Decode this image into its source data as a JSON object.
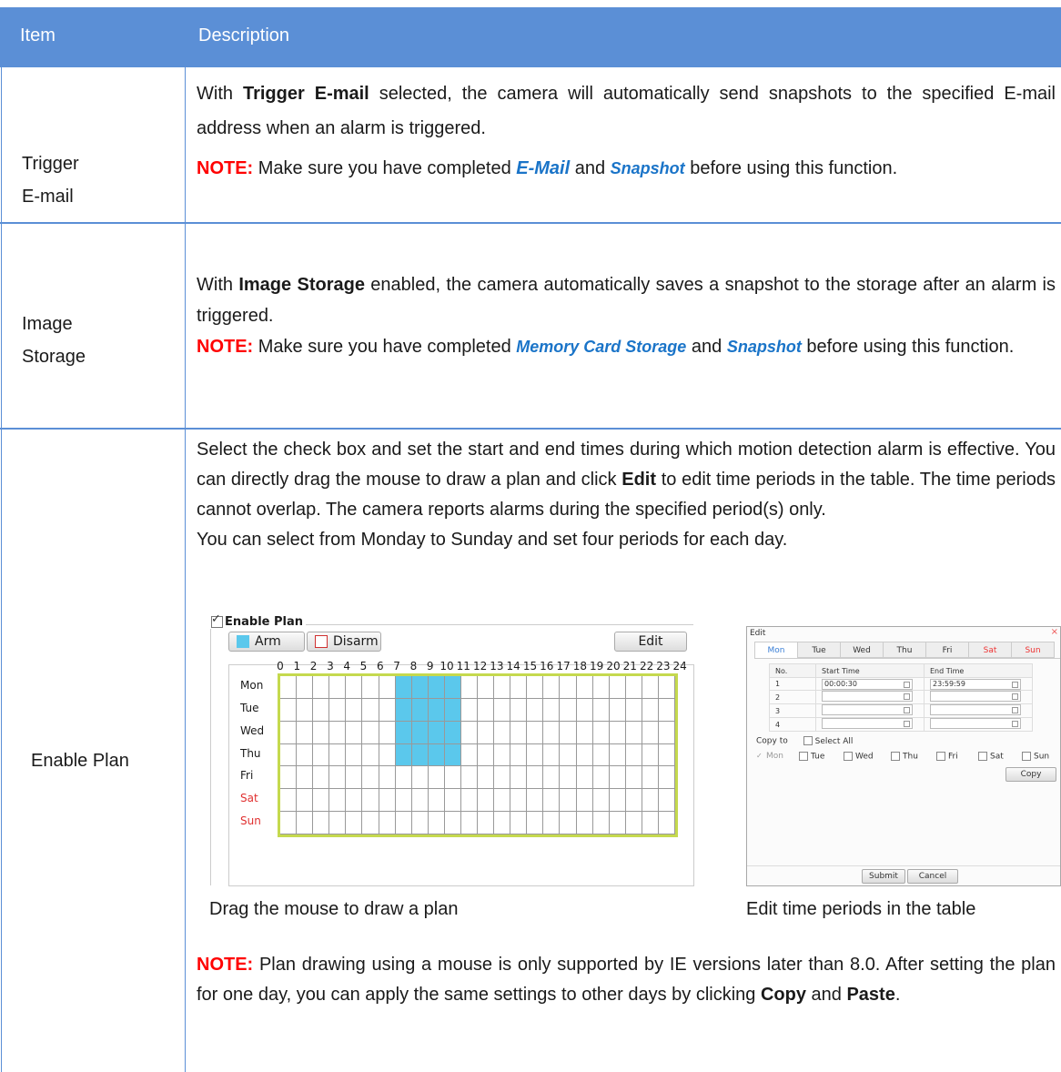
{
  "header": {
    "item": "Item",
    "description": "Description"
  },
  "rows": [
    {
      "item_line1": "Trigger",
      "item_line2": "E-mail",
      "p1_pre": "With ",
      "p1_bold": "Trigger E-mail",
      "p1_post": " selected, the camera will automatically send snapshots to the specified E-mail address when an alarm is triggered.",
      "note_label": "NOTE:",
      "note_pre": " Make sure you have completed ",
      "link1": "E-Mail",
      "note_mid": " and ",
      "link2": "Snapshot",
      "note_post": "  before using this function."
    },
    {
      "item_line1": "Image",
      "item_line2": "Storage",
      "p1_pre": "With ",
      "p1_bold": "Image Storage",
      "p1_post": " enabled, the camera automatically saves a snapshot to the storage after an alarm is triggered.",
      "note_label": "NOTE:",
      "note_pre": " Make sure you have completed ",
      "link1": "Memory Card Storage",
      "note_mid": " and ",
      "link2": "Snapshot",
      "note_post": " before using this function."
    },
    {
      "item": "Enable Plan",
      "p1_pre": "Select the check box and set the start and end times during which motion detection alarm is effective. You can directly drag the mouse to draw a plan and click ",
      "p1_bold": "Edit",
      "p1_post": " to edit time periods in the table. The time periods cannot overlap. The camera reports alarms during the specified period(s) only.",
      "p2": "You can select from Monday to Sunday and set four periods for each day.",
      "caption_left": "Drag the mouse to draw a plan",
      "caption_right": "Edit time periods in the table",
      "note_label": "NOTE:",
      "note_pre": " Plan drawing using a mouse is only supported by IE versions later than 8.0. After setting the plan for one day, you can apply the same settings to other days by clicking ",
      "note_b1": "Copy",
      "note_mid": " and ",
      "note_b2": "Paste",
      "note_post": "."
    }
  ],
  "plan_ui": {
    "title": "Enable Plan",
    "enabled": true,
    "arm_label": "Arm",
    "disarm_label": "Disarm",
    "edit_label": "Edit",
    "hours": [
      "0",
      "1",
      "2",
      "3",
      "4",
      "5",
      "6",
      "7",
      "8",
      "9",
      "10",
      "11",
      "12",
      "13",
      "14",
      "15",
      "16",
      "17",
      "18",
      "19",
      "20",
      "21",
      "22",
      "23",
      "24"
    ],
    "days": [
      "Mon",
      "Tue",
      "Wed",
      "Thu",
      "Fri",
      "Sat",
      "Sun"
    ],
    "weekend_color": "#e03030",
    "arm_color": "#5bc8ec",
    "grid_border_color": "#c5d94e",
    "armed_cells": {
      "days": [
        0,
        1,
        2,
        3
      ],
      "hours": [
        7,
        8,
        9,
        10
      ]
    }
  },
  "edit_ui": {
    "title": "Edit",
    "close": "×",
    "tabs": [
      "Mon",
      "Tue",
      "Wed",
      "Thu",
      "Fri",
      "Sat",
      "Sun"
    ],
    "active_tab": "Mon",
    "col_no": "No.",
    "col_start": "Start Time",
    "col_end": "End Time",
    "rows": [
      {
        "no": "1",
        "start": "00:00:30",
        "end": "23:59:59"
      },
      {
        "no": "2",
        "start": "",
        "end": ""
      },
      {
        "no": "3",
        "start": "",
        "end": ""
      },
      {
        "no": "4",
        "start": "",
        "end": ""
      }
    ],
    "copy_to": "Copy to",
    "select_all": "Select All",
    "days": [
      "Mon",
      "Tue",
      "Wed",
      "Thu",
      "Fri",
      "Sat",
      "Sun"
    ],
    "copy_btn": "Copy",
    "submit_btn": "Submit",
    "cancel_btn": "Cancel"
  }
}
